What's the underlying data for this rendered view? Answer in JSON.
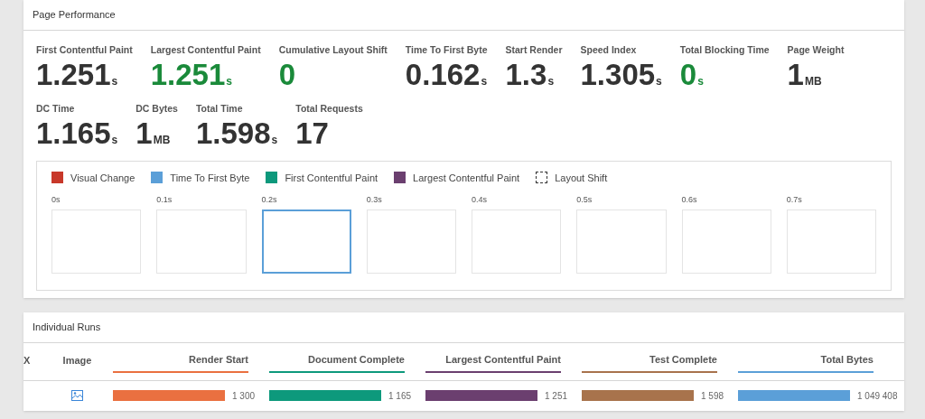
{
  "performance": {
    "title": "Page Performance",
    "metric_rows": [
      [
        {
          "label": "First Contentful Paint",
          "value": "1.251",
          "unit": "s",
          "good": false
        },
        {
          "label": "Largest Contentful Paint",
          "value": "1.251",
          "unit": "s",
          "good": true
        },
        {
          "label": "Cumulative Layout Shift",
          "value": "0",
          "good": true
        },
        {
          "label": "Time To First Byte",
          "value": "0.162",
          "unit": "s",
          "good": false
        },
        {
          "label": "Start Render",
          "value": "1.3",
          "unit": "s",
          "good": false
        },
        {
          "label": "Speed Index",
          "value": "1.305",
          "unit": "s",
          "good": false
        },
        {
          "label": "Total Blocking Time",
          "value": "0",
          "unit": "s",
          "good": true
        },
        {
          "label": "Page Weight",
          "value": "1",
          "unit": "MB",
          "good": false
        }
      ],
      [
        {
          "label": "DC Time",
          "value": "1.165",
          "unit": "s",
          "good": false
        },
        {
          "label": "DC Bytes",
          "value": "1",
          "unit": "MB",
          "good": false
        },
        {
          "label": "Total Time",
          "value": "1.598",
          "unit": "s",
          "good": false
        },
        {
          "label": "Total Requests",
          "value": "17",
          "good": false
        }
      ]
    ],
    "legend": [
      {
        "label": "Visual Change",
        "kind": "solid",
        "color": "#c8382a"
      },
      {
        "label": "Time To First Byte",
        "kind": "solid",
        "color": "#5b9fd8"
      },
      {
        "label": "First Contentful Paint",
        "kind": "solid",
        "color": "#0d997c"
      },
      {
        "label": "Largest Contentful Paint",
        "kind": "solid",
        "color": "#6b3f6f"
      },
      {
        "label": "Layout Shift",
        "kind": "dashed"
      }
    ],
    "frames": [
      {
        "time": "0s",
        "selected": false
      },
      {
        "time": "0.1s",
        "selected": false
      },
      {
        "time": "0.2s",
        "selected": true
      },
      {
        "time": "0.3s",
        "selected": false
      },
      {
        "time": "0.4s",
        "selected": false
      },
      {
        "time": "0.5s",
        "selected": false
      },
      {
        "time": "0.6s",
        "selected": false
      },
      {
        "time": "0.7s",
        "selected": false
      }
    ]
  },
  "runs": {
    "title": "Individual Runs",
    "column_1": "X",
    "image_column": "Image",
    "columns": [
      {
        "label": "Render Start",
        "color": "#ea7040",
        "value": "1 300"
      },
      {
        "label": "Document Complete",
        "color": "#0d997c",
        "value": "1 165"
      },
      {
        "label": "Largest Contentful Paint",
        "color": "#6b3f6f",
        "value": "1 251"
      },
      {
        "label": "Test Complete",
        "color": "#a8734c",
        "value": "1 598"
      },
      {
        "label": "Total Bytes",
        "color": "#5b9fd8",
        "value": "1 049 408"
      }
    ]
  }
}
